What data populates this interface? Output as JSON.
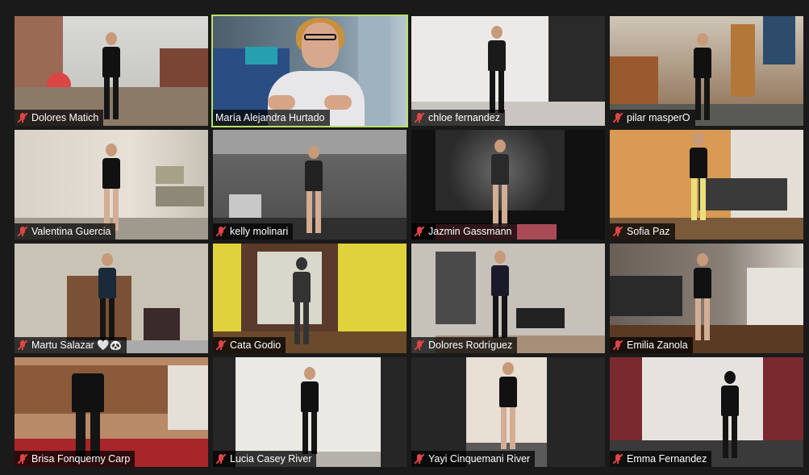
{
  "meeting": {
    "active_speaker_border_color": "#b9e068",
    "muted_icon_color": "#e04545",
    "participants": [
      {
        "name": "Dolores Matich",
        "muted": true
      },
      {
        "name": "María Alejandra Hurtado",
        "muted": false,
        "active_speaker": true
      },
      {
        "name": "chloe fernandez",
        "muted": true
      },
      {
        "name": "pilar masperO",
        "muted": true
      },
      {
        "name": "Valentina Guercia",
        "muted": true
      },
      {
        "name": "kelly molinari",
        "muted": true
      },
      {
        "name": "Jazmin Gassmann",
        "muted": true
      },
      {
        "name": "Sofia Paz",
        "muted": true
      },
      {
        "name": "Martu Salazar 🤍🐼",
        "muted": true
      },
      {
        "name": "Cata Godio",
        "muted": true
      },
      {
        "name": "Dolores Rodríguez",
        "muted": true
      },
      {
        "name": "Emilia  Zanola",
        "muted": true
      },
      {
        "name": "Brisa Fonquerny Carp",
        "muted": true
      },
      {
        "name": "Lucia Casey River",
        "muted": true
      },
      {
        "name": "Yayi Cinquemani River",
        "muted": true
      },
      {
        "name": "Emma Fernandez",
        "muted": true
      }
    ]
  }
}
